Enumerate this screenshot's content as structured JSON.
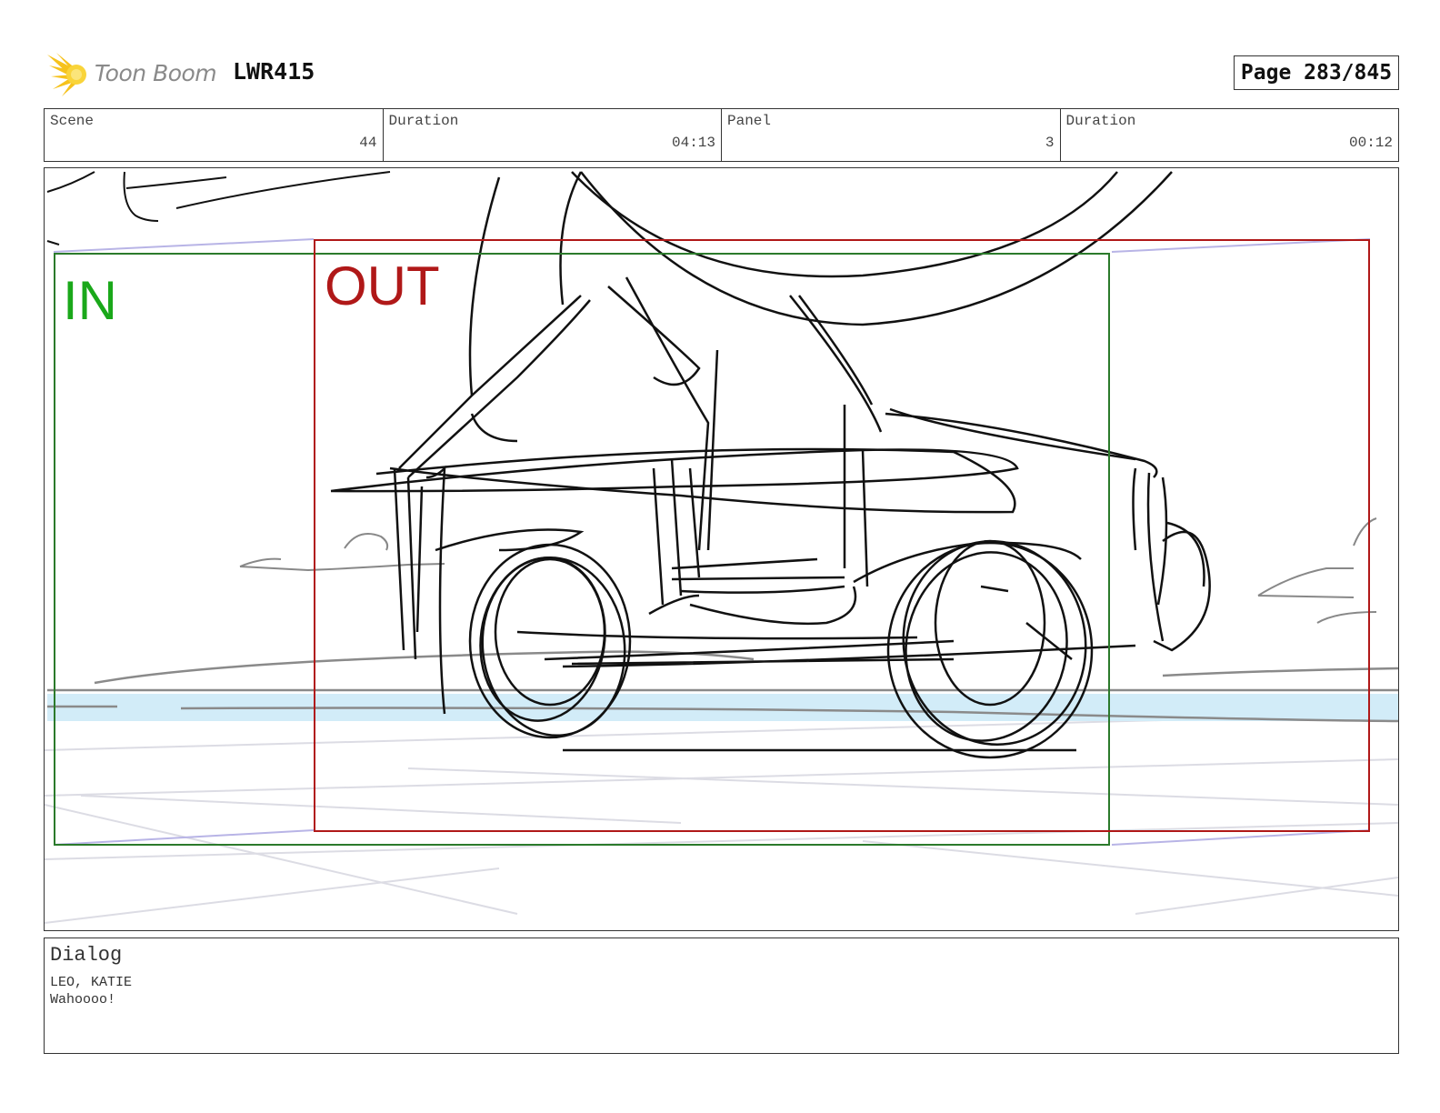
{
  "header": {
    "logo_text": "Toon Boom",
    "project": "LWR415",
    "page": "Page 283/845"
  },
  "info": {
    "scene_label": "Scene",
    "scene_value": "44",
    "scene_duration_label": "Duration",
    "scene_duration_value": "04:13",
    "panel_label": "Panel",
    "panel_value": "3",
    "panel_duration_label": "Duration",
    "panel_duration_value": "00:12"
  },
  "frame": {
    "in_label": "IN",
    "out_label": "OUT",
    "in_color": "#1aa81a",
    "out_color": "#b01818"
  },
  "dialog": {
    "title": "Dialog",
    "speaker": "LEO, KATIE",
    "line": "Wahoooo!"
  }
}
